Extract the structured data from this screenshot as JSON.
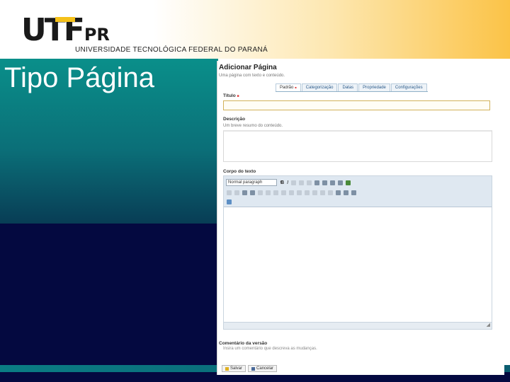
{
  "slide": {
    "logo_main": "UTF",
    "logo_pr": "PR",
    "university": "UNIVERSIDADE TECNOLÓGICA FEDERAL DO PARANÁ",
    "title": "Tipo Página"
  },
  "form": {
    "heading": "Adicionar Página",
    "subheading": "Uma página com texto e conteúdo.",
    "tabs": [
      "Padrão",
      "Categorização",
      "Datas",
      "Propriedade",
      "Configurações"
    ],
    "active_tab": "Padrão",
    "title_label": "Título",
    "required_mark": "■",
    "title_value": "",
    "description_label": "Descrição",
    "description_help": "Um breve resumo do conteúdo.",
    "description_value": "",
    "body_label": "Corpo do texto",
    "format_selected": "Normal paragraph",
    "bold_label": "B",
    "italic_label": "I",
    "comment_label": "Comentário da versão",
    "comment_help": "Insira um comentário que descreva as mudanças.",
    "save_label": "Salvar",
    "cancel_label": "Cancelar",
    "resize_glyph": "◢"
  },
  "colors": {
    "header_accent": "#fbc347",
    "teal": "#0a8f8a",
    "navy": "#040940",
    "required": "#dd3333"
  }
}
